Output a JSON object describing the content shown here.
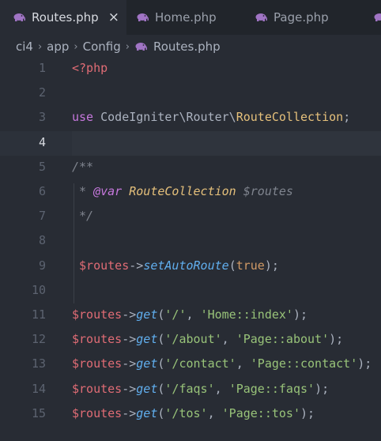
{
  "tabs": [
    {
      "label": "Routes.php",
      "active": true,
      "close": "×"
    },
    {
      "label": "Home.php",
      "active": false
    },
    {
      "label": "Page.php",
      "active": false
    }
  ],
  "breadcrumb": [
    "ci4",
    "app",
    "Config",
    "Routes.php"
  ],
  "breadcrumb_separator": "›",
  "editor": {
    "current_line": 4,
    "lines": [
      {
        "n": "1",
        "tokens": [
          [
            "tag",
            "<?php"
          ]
        ]
      },
      {
        "n": "2",
        "tokens": []
      },
      {
        "n": "3",
        "tokens": [
          [
            "kw",
            "use"
          ],
          [
            "plain",
            " CodeIgniter\\Router\\"
          ],
          [
            "class",
            "RouteCollection"
          ],
          [
            "punct",
            ";"
          ]
        ]
      },
      {
        "n": "4",
        "tokens": []
      },
      {
        "n": "5",
        "tokens": [
          [
            "comment",
            "/**"
          ]
        ]
      },
      {
        "n": "6",
        "tokens": [
          [
            "comment",
            " * "
          ],
          [
            "doctag",
            "@var"
          ],
          [
            "comment",
            " "
          ],
          [
            "doctype",
            "RouteCollection"
          ],
          [
            "comment",
            " $routes"
          ]
        ]
      },
      {
        "n": "7",
        "tokens": [
          [
            "comment",
            " */"
          ]
        ]
      },
      {
        "n": "8",
        "tokens": []
      },
      {
        "n": "9",
        "tokens": [
          [
            "var",
            " $routes"
          ],
          [
            "punct",
            "->"
          ],
          [
            "fn",
            "setAutoRoute"
          ],
          [
            "punct",
            "("
          ],
          [
            "bool",
            "true"
          ],
          [
            "punct",
            ");"
          ]
        ]
      },
      {
        "n": "10",
        "tokens": []
      },
      {
        "n": "11",
        "tokens": [
          [
            "var",
            "$routes"
          ],
          [
            "punct",
            "->"
          ],
          [
            "fn",
            "get"
          ],
          [
            "punct",
            "("
          ],
          [
            "str",
            "'/'"
          ],
          [
            "punct",
            ", "
          ],
          [
            "str",
            "'Home::index'"
          ],
          [
            "punct",
            ");"
          ]
        ]
      },
      {
        "n": "12",
        "tokens": [
          [
            "var",
            "$routes"
          ],
          [
            "punct",
            "->"
          ],
          [
            "fn",
            "get"
          ],
          [
            "punct",
            "("
          ],
          [
            "str",
            "'/about'"
          ],
          [
            "punct",
            ", "
          ],
          [
            "str",
            "'Page::about'"
          ],
          [
            "punct",
            ");"
          ]
        ]
      },
      {
        "n": "13",
        "tokens": [
          [
            "var",
            "$routes"
          ],
          [
            "punct",
            "->"
          ],
          [
            "fn",
            "get"
          ],
          [
            "punct",
            "("
          ],
          [
            "str",
            "'/contact'"
          ],
          [
            "punct",
            ", "
          ],
          [
            "str",
            "'Page::contact'"
          ],
          [
            "punct",
            ");"
          ]
        ]
      },
      {
        "n": "14",
        "tokens": [
          [
            "var",
            "$routes"
          ],
          [
            "punct",
            "->"
          ],
          [
            "fn",
            "get"
          ],
          [
            "punct",
            "("
          ],
          [
            "str",
            "'/faqs'"
          ],
          [
            "punct",
            ", "
          ],
          [
            "str",
            "'Page::faqs'"
          ],
          [
            "punct",
            ");"
          ]
        ]
      },
      {
        "n": "15",
        "tokens": [
          [
            "var",
            "$routes"
          ],
          [
            "punct",
            "->"
          ],
          [
            "fn",
            "get"
          ],
          [
            "punct",
            "("
          ],
          [
            "str",
            "'/tos'"
          ],
          [
            "punct",
            ", "
          ],
          [
            "str",
            "'Page::tos'"
          ],
          [
            "punct",
            ");"
          ]
        ]
      }
    ]
  },
  "colors": {
    "background": "#282c34",
    "tabbar": "#21252b",
    "php_icon": "#a074c4"
  },
  "icons": {
    "file_type": "php-elephant-icon"
  }
}
